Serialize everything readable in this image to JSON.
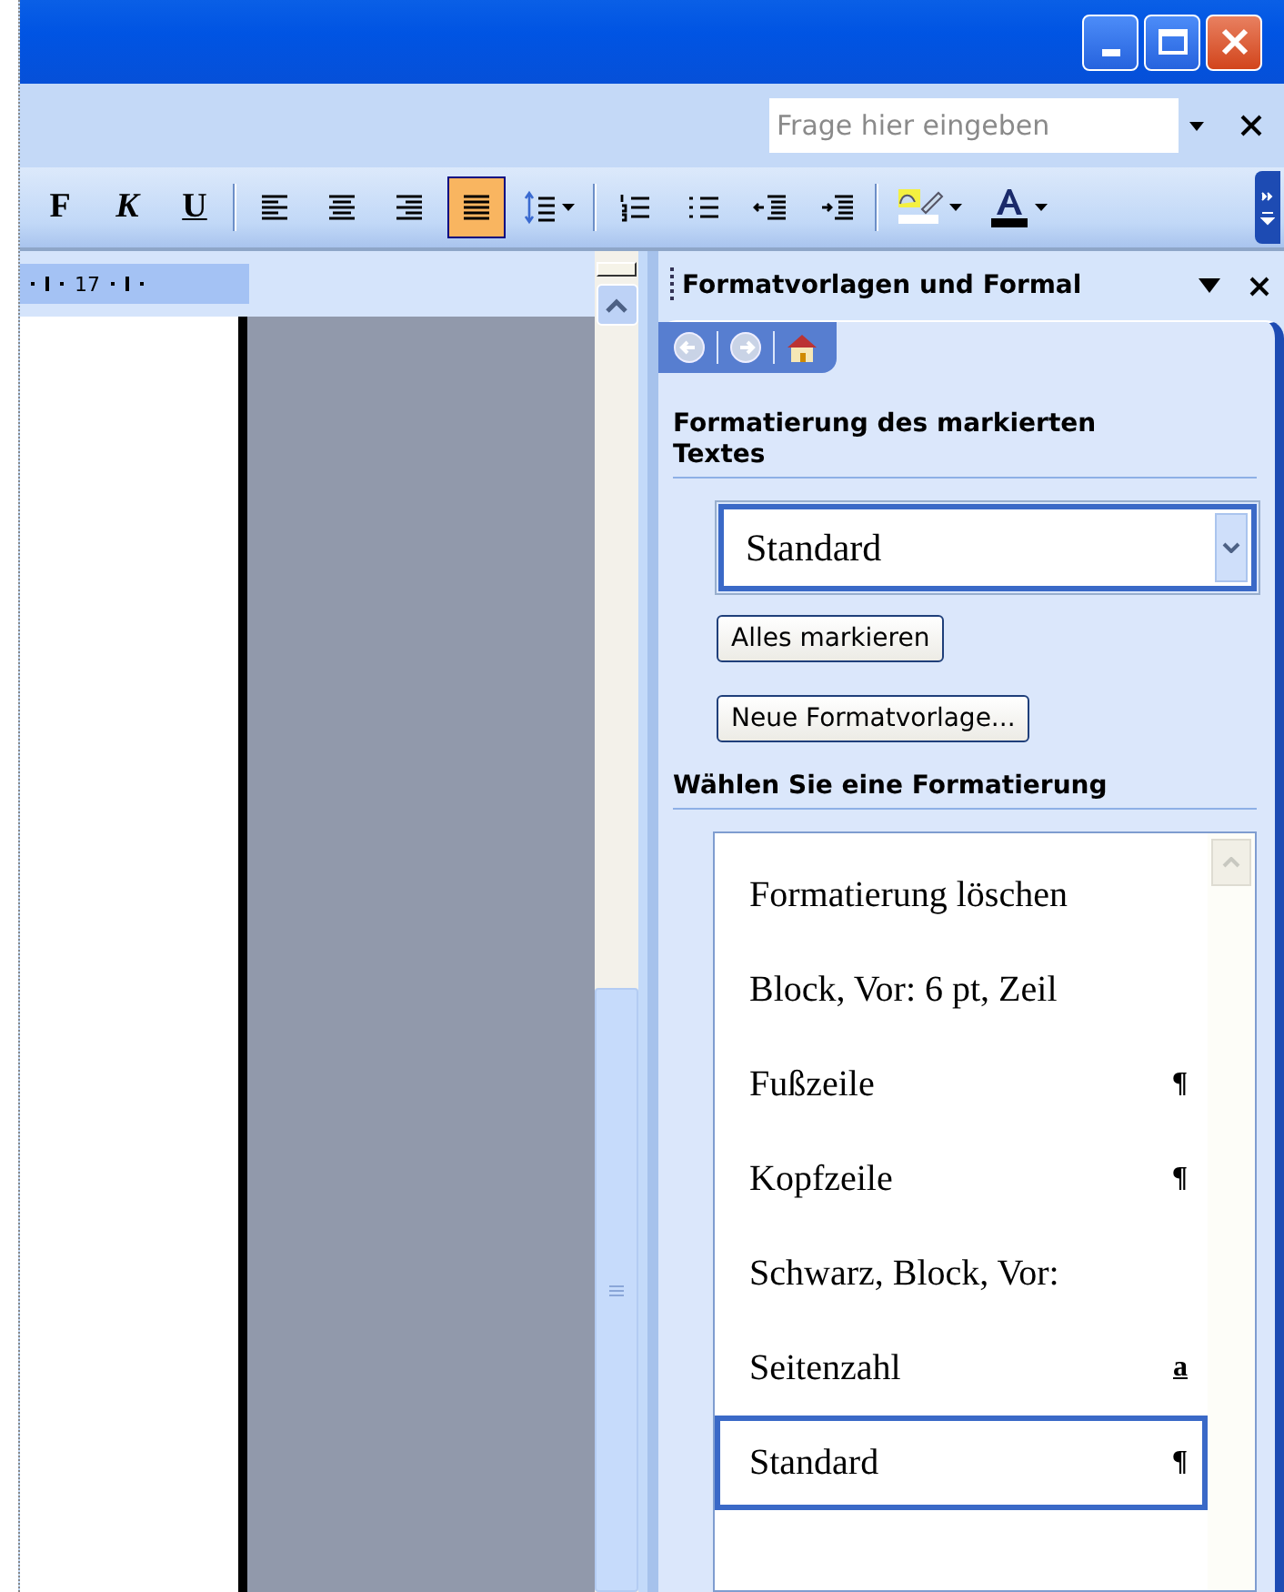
{
  "help_field": {
    "placeholder": "Frage hier eingeben"
  },
  "toolbar": [
    {
      "kind": "bold",
      "label": "F",
      "selected": false
    },
    {
      "kind": "italic",
      "label": "K",
      "selected": false
    },
    {
      "kind": "underline",
      "label": "U",
      "selected": false
    },
    {
      "kind": "separator"
    },
    {
      "kind": "align-left",
      "selected": false
    },
    {
      "kind": "align-center",
      "selected": false
    },
    {
      "kind": "align-right",
      "selected": false
    },
    {
      "kind": "justify",
      "selected": true
    },
    {
      "kind": "line-spacing",
      "selected": false
    },
    {
      "kind": "separator"
    },
    {
      "kind": "numbered-list",
      "selected": false
    },
    {
      "kind": "bullet-list",
      "selected": false
    },
    {
      "kind": "outdent",
      "selected": false
    },
    {
      "kind": "indent",
      "selected": false
    },
    {
      "kind": "separator"
    },
    {
      "kind": "highlight",
      "selected": false
    },
    {
      "kind": "font-color",
      "selected": false
    }
  ],
  "ruler": {
    "label": "17"
  },
  "task_pane": {
    "title": "Formatvorlagen und Formal",
    "section_1": {
      "heading": "Formatierung des markierten Textes",
      "current_style": "Standard",
      "buttons": [
        "Alles markieren",
        "Neue Formatvorlage..."
      ]
    },
    "section_2": {
      "heading": "Wählen Sie eine Formatierung",
      "styles": [
        {
          "label": "Formatierung löschen",
          "selected": false
        },
        {
          "label": "Block, Vor:  6 pt, Zeil",
          "selected": false
        },
        {
          "label": "Fußzeile",
          "kind": "paragraph",
          "mark": "¶",
          "selected": false
        },
        {
          "label": "Kopfzeile",
          "kind": "paragraph",
          "mark": "¶",
          "selected": false
        },
        {
          "label": "Schwarz, Block, Vor:",
          "selected": false
        },
        {
          "label": "Seitenzahl",
          "kind": "character",
          "mark": "a",
          "selected": false
        },
        {
          "label": "Standard",
          "kind": "paragraph",
          "mark": "¶",
          "selected": true
        }
      ]
    }
  }
}
